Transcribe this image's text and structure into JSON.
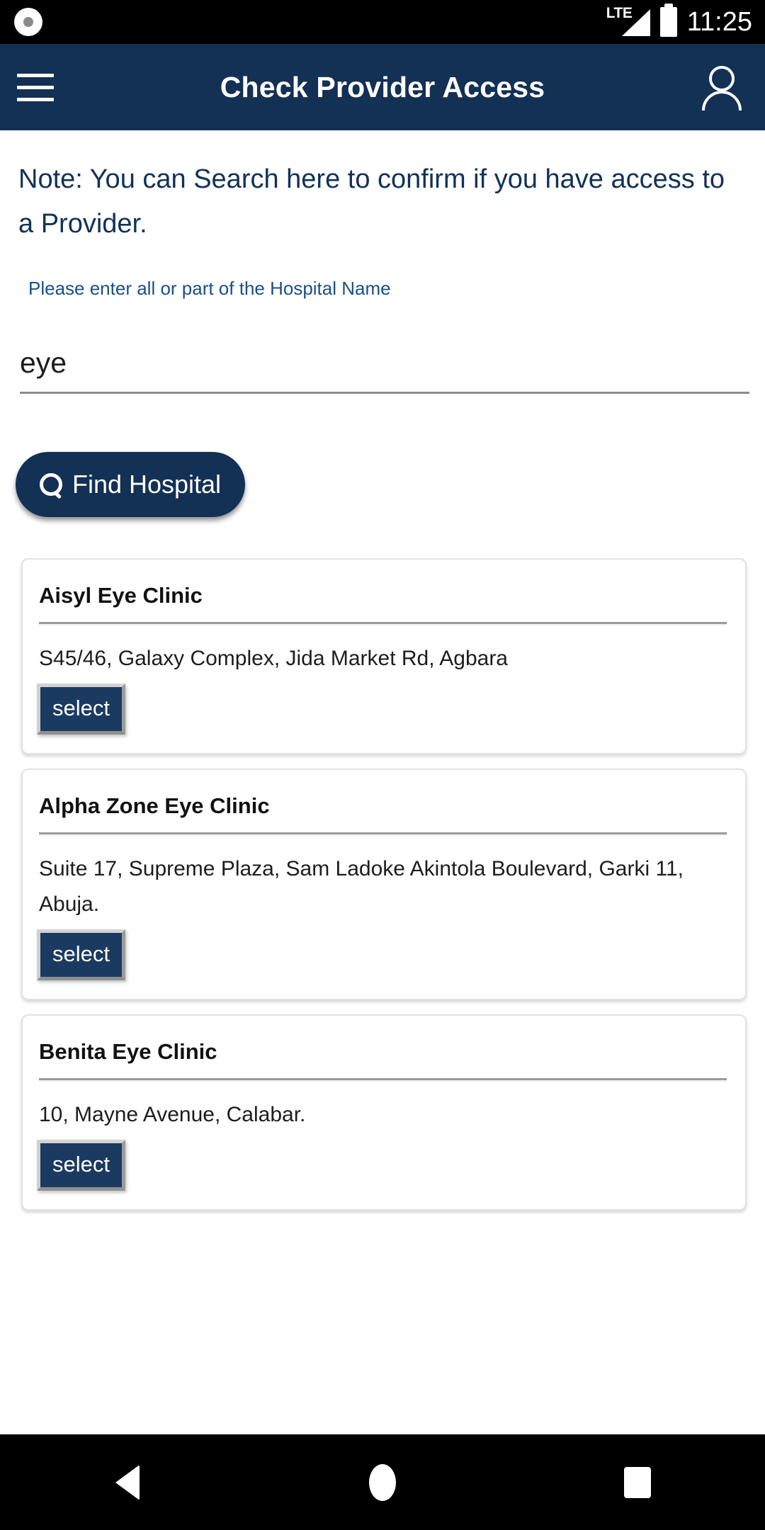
{
  "status_bar": {
    "record_icon": "record-dot-icon",
    "network_label": "LTE",
    "signal_icon": "signal-triangle-icon",
    "battery_icon": "battery-full-icon",
    "time": "11:25"
  },
  "app_bar": {
    "menu_icon": "hamburger-menu-icon",
    "title": "Check Provider Access",
    "profile_icon": "user-profile-icon",
    "background_color": "#133055"
  },
  "main": {
    "note": "Note: You can Search here to confirm if you have access to a Provider.",
    "field_label": "Please enter all or part of the Hospital Name",
    "search_input": {
      "value": "eye",
      "placeholder": "Please enter all or part of the Hospital Name"
    },
    "find_button": {
      "label": "Find Hospital",
      "icon": "search-icon"
    }
  },
  "results": [
    {
      "name": "Aisyl Eye Clinic",
      "address": "S45/46, Galaxy Complex, Jida Market Rd, Agbara",
      "select_label": "select"
    },
    {
      "name": "Alpha Zone Eye Clinic",
      "address": "Suite 17, Supreme Plaza, Sam Ladoke Akintola Boulevard, Garki 11, Abuja.",
      "select_label": "select"
    },
    {
      "name": "Benita Eye Clinic",
      "address": "10, Mayne Avenue, Calabar.",
      "select_label": "select"
    }
  ],
  "nav_bar": {
    "back": "back-triangle-icon",
    "home": "home-circle-icon",
    "recents": "recents-square-icon"
  }
}
